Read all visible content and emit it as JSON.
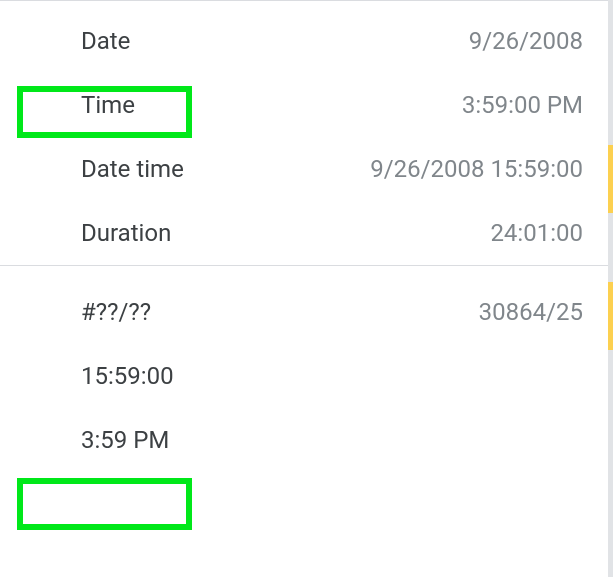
{
  "section1": {
    "rows": [
      {
        "label": "Date",
        "value": "9/26/2008"
      },
      {
        "label": "Time",
        "value": "3:59:00 PM"
      },
      {
        "label": "Date time",
        "value": "9/26/2008 15:59:00"
      },
      {
        "label": "Duration",
        "value": "24:01:00"
      }
    ]
  },
  "section2": {
    "rows": [
      {
        "label": "#??/??",
        "value": "30864/25"
      },
      {
        "label": "15:59:00",
        "value": ""
      },
      {
        "label": "3:59 PM",
        "value": ""
      }
    ]
  }
}
